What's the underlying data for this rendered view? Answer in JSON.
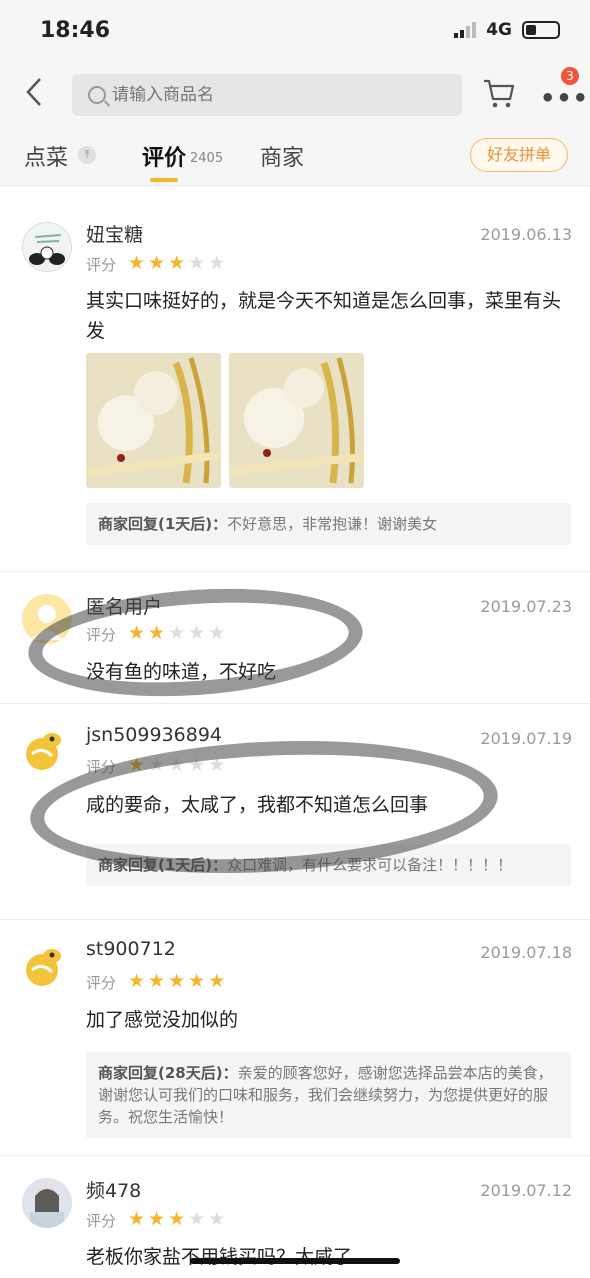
{
  "status": {
    "time": "18:46",
    "network": "4G"
  },
  "nav": {
    "search_placeholder": "请输入商品名",
    "badge_count": "3"
  },
  "tabs": {
    "dishes": "点菜",
    "reviews": "评价",
    "reviews_count": "2405",
    "merchant": "商家",
    "group_order": "好友拼单"
  },
  "rating_label": "评分",
  "reviews": [
    {
      "user": "妞宝糖",
      "date": "2019.06.13",
      "stars": 3,
      "text": "其实口味挺好的，就是今天不知道是怎么回事，菜里有头发",
      "reply_label": "商家回复(1天后)：",
      "reply_text": "不好意思，非常抱谦！谢谢美女"
    },
    {
      "user": "匿名用户",
      "date": "2019.07.23",
      "stars": 2,
      "text": "没有鱼的味道，不好吃"
    },
    {
      "user": "jsn509936894",
      "date": "2019.07.19",
      "stars": 1,
      "text": "咸的要命，太咸了，我都不知道怎么回事",
      "reply_label": "商家回复(1天后)：",
      "reply_text": "众口难调，有什么要求可以备注！！！！！"
    },
    {
      "user": "st900712",
      "date": "2019.07.18",
      "stars": 5,
      "text": "加了感觉没加似的",
      "reply_label": "商家回复(28天后)：",
      "reply_text": "亲爱的顾客您好，感谢您选择品尝本店的美食，谢谢您认可我们的口味和服务，我们会继续努力，为您提供更好的服务。祝您生活愉快！"
    },
    {
      "user": "频478",
      "date": "2019.07.12",
      "stars": 3,
      "text": "老板你家盐不用钱买吗？太咸了"
    }
  ],
  "colors": {
    "accent": "#f5b52b",
    "badge": "#f0553a",
    "group_button": "#e8913a"
  }
}
